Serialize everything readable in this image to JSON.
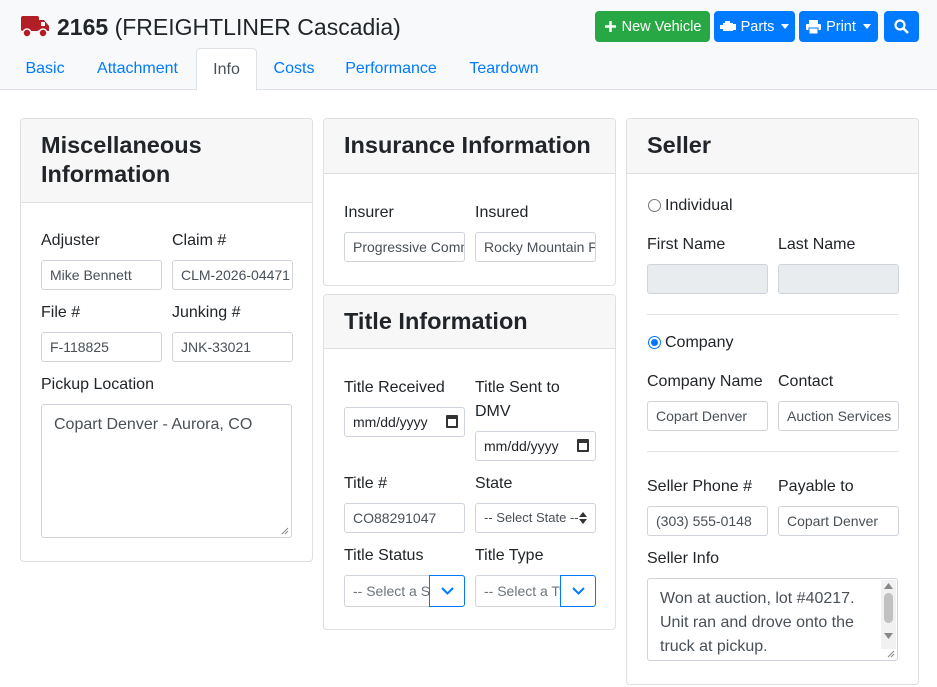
{
  "header": {
    "vehicle_number": "2165",
    "vehicle_model": "(FREIGHTLINER Cascadia)",
    "buttons": {
      "new_vehicle": "New Vehicle",
      "parts": "Parts",
      "print": "Print"
    },
    "tabs": [
      "Basic",
      "Attachment",
      "Info",
      "Costs",
      "Performance",
      "Teardown"
    ],
    "active_tab": "Info"
  },
  "misc": {
    "title": "Miscellaneous Information",
    "title_line1": "Miscellaneous",
    "title_line2": "Information",
    "adjuster_label": "Adjuster",
    "adjuster_value": "Mike Bennett",
    "claim_label": "Claim #",
    "claim_value": "CLM-2026-04471",
    "file_label": "File #",
    "file_value": "F-118825",
    "junking_label": "Junking #",
    "junking_value": "JNK-33021",
    "pickup_label": "Pickup Location",
    "pickup_value": "Copart Denver - Aurora, CO"
  },
  "insurance": {
    "title": "Insurance Information",
    "insurer_label": "Insurer",
    "insurer_value": "Progressive Commercial",
    "insured_label": "Insured",
    "insured_value": "Rocky Mountain Freight"
  },
  "title_info": {
    "title": "Title Information",
    "received_label": "Title Received",
    "received_placeholder": "mm/dd/yyyy",
    "sent_label_line1": "Title Sent to",
    "sent_label_line2": "DMV",
    "sent_placeholder": "mm/dd/yyyy",
    "number_label": "Title #",
    "number_value": "CO88291047",
    "state_label": "State",
    "state_value": "-- Select State --",
    "status_label": "Title Status",
    "status_value": "-- Select a Status --",
    "type_label": "Title Type",
    "type_value": "-- Select a Type --"
  },
  "seller": {
    "title": "Seller",
    "individual_label": "Individual",
    "first_name_label": "First Name",
    "first_name_value": "",
    "last_name_label": "Last Name",
    "last_name_value": "",
    "company_label": "Company",
    "company_name_label": "Company Name",
    "company_name_value": "Copart Denver",
    "contact_label": "Contact",
    "contact_value": "Auction Services",
    "phone_label": "Seller Phone #",
    "phone_value": "(303) 555-0148",
    "payable_label": "Payable to",
    "payable_value": "Copart Denver",
    "info_label": "Seller Info",
    "info_value": "Won at auction, lot #40217. Unit ran and drove onto the truck at pickup."
  },
  "colors": {
    "primary": "#007bff",
    "success": "#28a745",
    "truck_icon": "#b21e25"
  }
}
